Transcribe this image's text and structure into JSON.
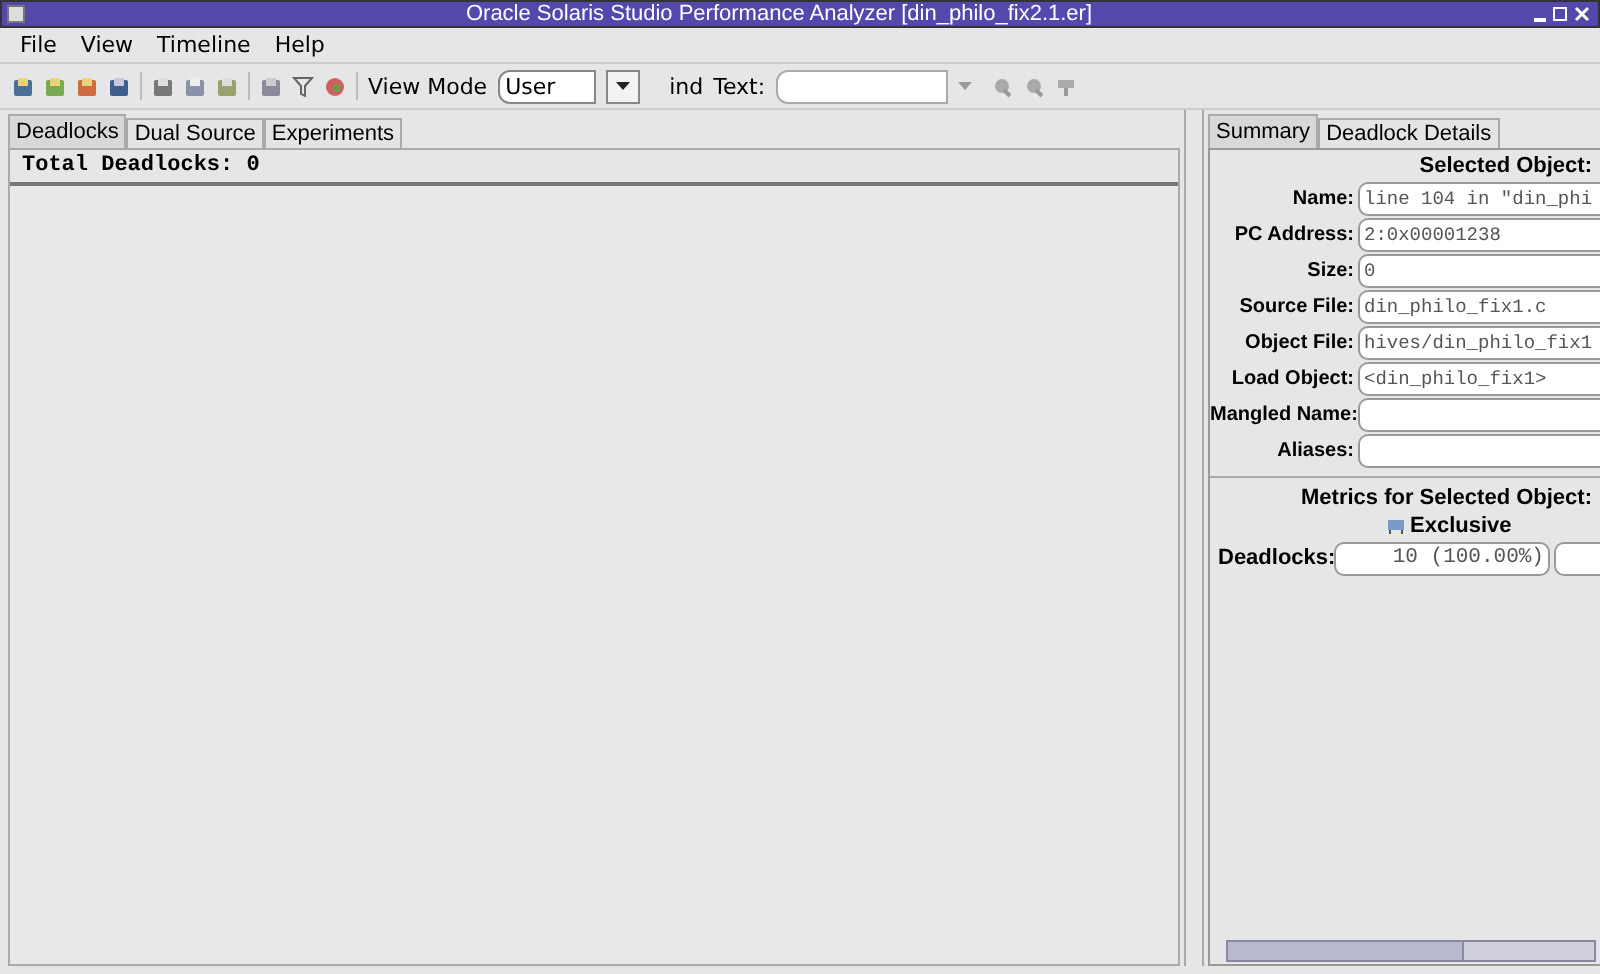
{
  "window": {
    "title": "Oracle Solaris Studio Performance Analyzer [din_philo_fix2.1.er]"
  },
  "menu": [
    "File",
    "View",
    "Timeline",
    "Help"
  ],
  "toolbar": {
    "view_mode_label": "View Mode",
    "view_mode": "User",
    "find_label": "ind",
    "text_label": "Text:"
  },
  "left_tabs": [
    {
      "label": "Deadlocks",
      "selected": true
    },
    {
      "label": "Dual Source",
      "selected": false
    },
    {
      "label": "Experiments",
      "selected": false
    }
  ],
  "deadlocks_header": "Total Deadlocks: 0",
  "right_tabs": [
    {
      "label": "Summary",
      "selected": true
    },
    {
      "label": "Deadlock Details",
      "selected": false
    }
  ],
  "selected_object": {
    "title": "Selected Object:",
    "fields": [
      {
        "label": "Name:",
        "value": "line 104 in \"din_phi"
      },
      {
        "label": "PC Address:",
        "value": "2:0x00001238"
      },
      {
        "label": "Size:",
        "value": "0"
      },
      {
        "label": "Source File:",
        "value": "din_philo_fix1.c"
      },
      {
        "label": "Object File:",
        "value": "hives/din_philo_fix1"
      },
      {
        "label": "Load Object:",
        "value": "<din_philo_fix1>"
      },
      {
        "label": "Mangled Name:"
      },
      {
        "label": "Aliases:"
      }
    ]
  },
  "metrics": {
    "title": "Metrics for Selected Object:",
    "column": "Exclusive",
    "rows": [
      {
        "label": "Deadlocks:",
        "value": "10 (100.00%)"
      }
    ]
  }
}
